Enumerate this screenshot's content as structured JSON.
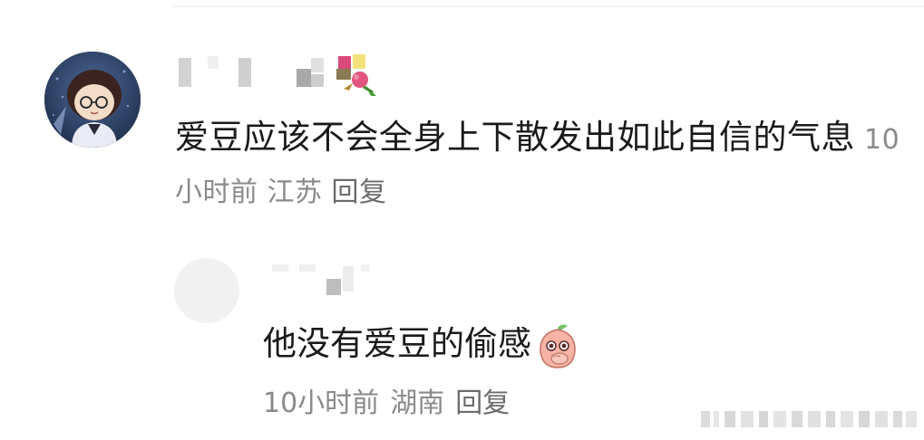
{
  "comment": {
    "username": "",
    "text": "爱豆应该不会全身上下散发出如此自信的气息",
    "time": "10小时前",
    "location": "江苏",
    "reply_label": "回复",
    "badge_icon": "bouquet-icon"
  },
  "reply": {
    "username": "",
    "text": "他没有爱豆的偷感",
    "emoji": "peach-cover-mouth-emoji",
    "time": "10小时前",
    "location": "湖南",
    "reply_label": "回复"
  },
  "colors": {
    "text": "#1a1a1a",
    "meta": "#8a8a8a",
    "divider": "#ececec"
  }
}
